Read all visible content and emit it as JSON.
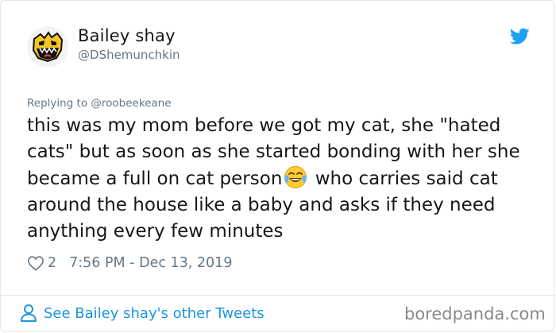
{
  "tweet": {
    "display_name": "Bailey shay",
    "handle": "@DShemunchkin",
    "replying_to": "Replying to @roobeekeane",
    "text_part1": "this was my mom before we got my cat, she \"hated cats\" but as soon as she started bonding with her she became a full on cat person",
    "text_part2": " who carries said cat around the house like a baby and asks if they need anything every few minutes",
    "emoji_icon": "face-with-tears-of-joy-emoji",
    "likes": "2",
    "timestamp": "7:56 PM - Dec 13, 2019"
  },
  "footer": {
    "see_more_label": "See Bailey shay's other Tweets",
    "watermark": "boredpanda.com"
  },
  "colors": {
    "twitter_blue": "#1b95e0",
    "meta_gray": "#657786",
    "text": "#14171a"
  },
  "icons": [
    "avatar",
    "twitter-bird-icon",
    "heart-icon",
    "person-icon"
  ]
}
